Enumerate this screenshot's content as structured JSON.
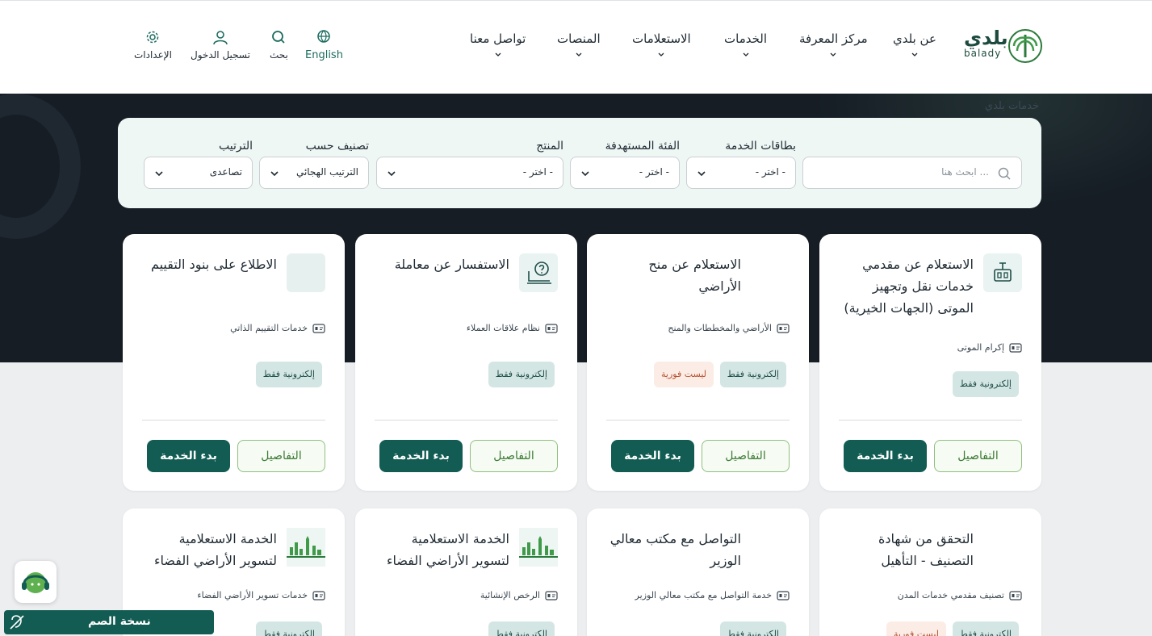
{
  "logo": {
    "arabic": "بلدي",
    "latin": "balady"
  },
  "nav": [
    {
      "label": "عن بلدي"
    },
    {
      "label": "مركز المعرفة"
    },
    {
      "label": "الخدمات"
    },
    {
      "label": "الاستعلامات"
    },
    {
      "label": "المنصات"
    },
    {
      "label": "تواصل معنا"
    }
  ],
  "utilities": {
    "language": "English",
    "search": "بحث",
    "login": "تسجيل الدخول",
    "settings": "الإعدادات"
  },
  "breadcrumb": "خدمات بلدي",
  "filters": {
    "search_placeholder": "ابحث هنا ...",
    "service_cards": {
      "label": "بطاقات الخدمة",
      "value": "- اختر -"
    },
    "target_group": {
      "label": "الفئة المستهدفة",
      "value": "- اختر -"
    },
    "product": {
      "label": "المنتج",
      "value": "- اختر -"
    },
    "classify_by": {
      "label": "تصنيف حسب",
      "value": "الترتيب الهجائي"
    },
    "sort": {
      "label": "الترتيب",
      "value": "تصاعدى"
    }
  },
  "card_buttons": {
    "details": "التفاصيل",
    "start": "بدء الخدمة"
  },
  "cards": [
    {
      "title": "الاستعلام عن مقدمي خدمات نقل وتجهيز الموتى (الجهات الخيرية)",
      "category": "إكرام الموتى",
      "tags": [
        "إلكترونية فقط"
      ],
      "icon": "robot-icon"
    },
    {
      "title": "الاستعلام عن منح الأراضي",
      "category": "الأراضي والمخططات والمنح",
      "tags": [
        "إلكترونية فقط",
        "ليست فورية"
      ],
      "icon": ""
    },
    {
      "title": "الاستفسار عن معاملة",
      "category": "نظام علاقات العملاء",
      "tags": [
        "إلكترونية فقط"
      ],
      "icon": "question-laptop-icon"
    },
    {
      "title": "الاطلاع على بنود التقييم",
      "category": "خدمات التقييم الذاتي",
      "tags": [
        "إلكترونية فقط"
      ],
      "icon": "placeholder-icon"
    },
    {
      "title": "التحقق من شهادة التصنيف - التأهيل",
      "category": "تصنيف مقدمي خدمات المدن",
      "tags": [
        "إلكترونية فقط",
        "ليست فورية"
      ],
      "icon": ""
    },
    {
      "title": "التواصل مع مكتب معالي الوزير",
      "category": "خدمة التواصل مع مكتب معالي الوزير",
      "tags": [
        "إلكترونية فقط"
      ],
      "icon": ""
    },
    {
      "title": "الخدمة الاستعلامية لتسوير الأراضي الفضاء",
      "category": "الرخص الإنشائية",
      "tags": [
        "إلكترونية فقط"
      ],
      "icon": "city-skyline-icon"
    },
    {
      "title": "الخدمة الاستعلامية لتسوير الأراضي الفضاء",
      "category": "خدمات تسوير الأراضي الفضاء",
      "tags": [
        "إلكترونية فقط"
      ],
      "icon": "city-skyline-icon"
    }
  ],
  "accessibility": {
    "deaf_version": "نسخة الصم"
  }
}
